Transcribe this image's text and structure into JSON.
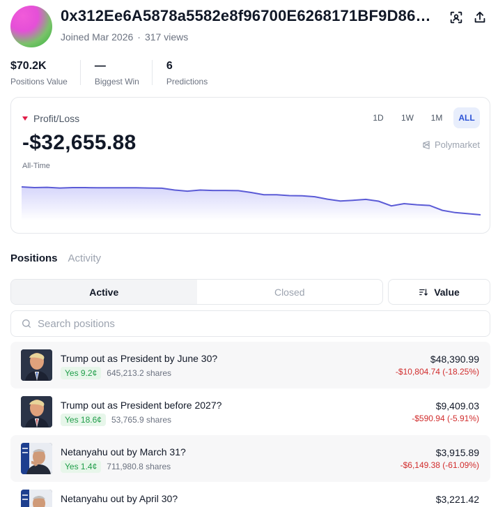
{
  "profile": {
    "address": "0x312Ee6A5878a5582e8f96700E6268171BF9D86…",
    "joined": "Joined Mar 2026",
    "separator": "·",
    "views": "317 views"
  },
  "stats": [
    {
      "value": "$70.2K",
      "label": "Positions Value"
    },
    {
      "value": "—",
      "label": "Biggest Win"
    },
    {
      "value": "6",
      "label": "Predictions"
    }
  ],
  "pnl": {
    "label": "Profit/Loss",
    "value": "-$32,655.88",
    "period": "All-Time",
    "brand": "Polymarket",
    "ranges": [
      "1D",
      "1W",
      "1M",
      "ALL"
    ],
    "active_range": "ALL",
    "line_color": "#5b5bd6",
    "series": [
      100,
      99.7,
      99.8,
      99.5,
      99.7,
      99.7,
      99.6,
      99.6,
      99.6,
      99.6,
      99.5,
      99.4,
      98.6,
      98.1,
      98.6,
      98.4,
      98.4,
      98.3,
      97.5,
      96.5,
      96.5,
      96.1,
      96.0,
      95.6,
      94.5,
      93.7,
      94.0,
      94.4,
      93.6,
      91.5,
      92.5,
      92.0,
      91.7,
      89.5,
      88.5,
      88.0,
      87.5
    ]
  },
  "tabs": [
    {
      "label": "Positions",
      "active": true
    },
    {
      "label": "Activity",
      "active": false
    }
  ],
  "segments": [
    {
      "label": "Active",
      "active": true
    },
    {
      "label": "Closed",
      "active": false
    }
  ],
  "sort": {
    "label": "Value"
  },
  "search": {
    "placeholder": "Search positions"
  },
  "positions": [
    {
      "title": "Trump out as President by June 30?",
      "outcome": "Yes 9.2¢",
      "shares": "645,213.2 shares",
      "value": "$48,390.99",
      "change": "-$10,804.74 (-18.25%)",
      "image": "trump"
    },
    {
      "title": "Trump out as President before 2027?",
      "outcome": "Yes 18.6¢",
      "shares": "53,765.9 shares",
      "value": "$9,409.03",
      "change": "-$590.94 (-5.91%)",
      "image": "trump"
    },
    {
      "title": "Netanyahu out by March 31?",
      "outcome": "Yes 1.4¢",
      "shares": "711,980.8 shares",
      "value": "$3,915.89",
      "change": "-$6,149.38 (-61.09%)",
      "image": "netanyahu"
    },
    {
      "title": "Netanyahu out by April 30?",
      "outcome": "",
      "shares": "",
      "value": "$3,221.42",
      "change": "",
      "image": "netanyahu"
    }
  ]
}
